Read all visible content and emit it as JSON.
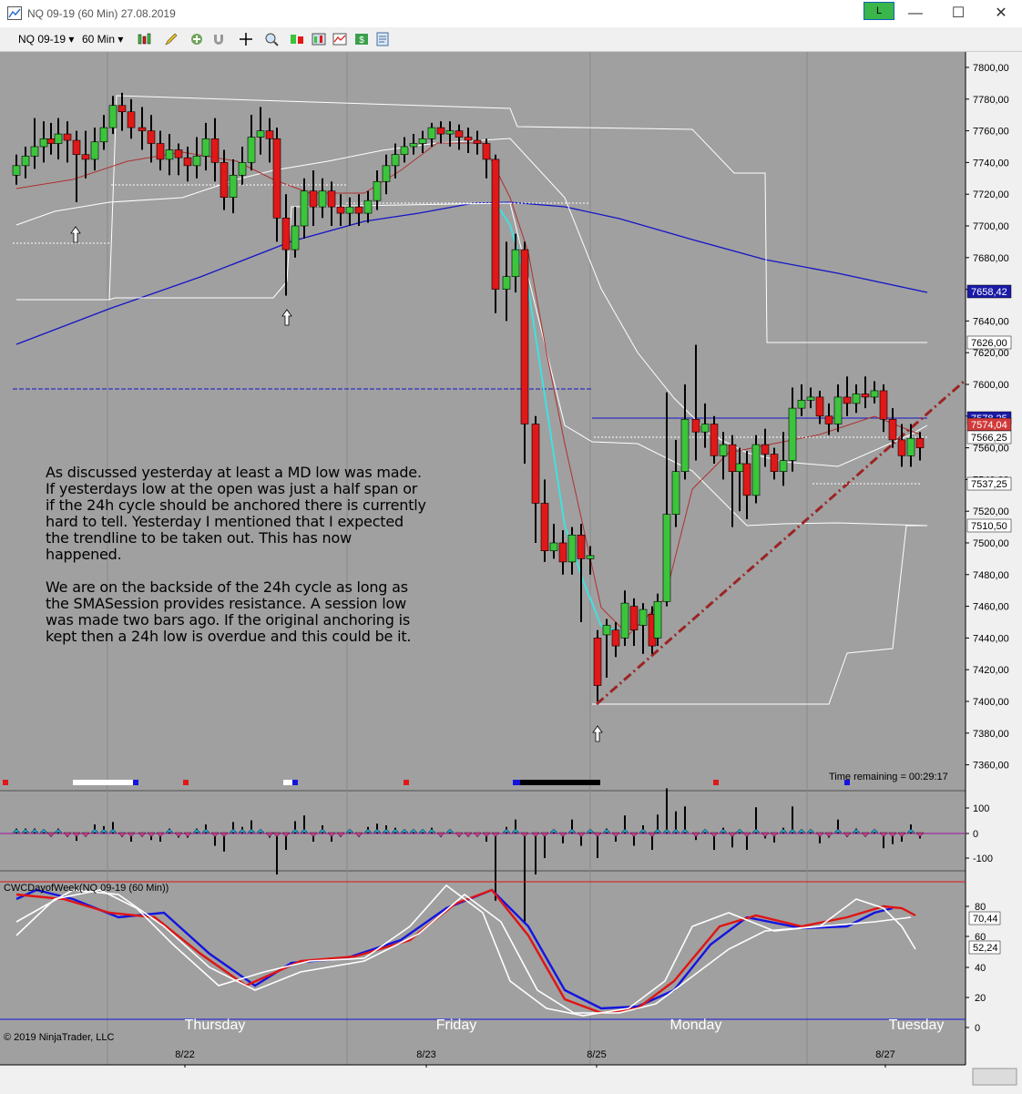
{
  "window": {
    "title": "NQ 09-19 (60 Min)  27.08.2019",
    "l_button": "L",
    "minimize": "—",
    "maximize": "☐",
    "close": "✕"
  },
  "toolbar": {
    "instrument": "NQ 09-19",
    "interval": "60 Min",
    "icons": [
      "bars-style-icon",
      "drawing-pencil-icon",
      "plus-icon",
      "magnet-icon",
      "crosshair-icon",
      "zoom-icon",
      "chart-trader-icon",
      "strategies-icon",
      "indicators-icon",
      "dollar-icon",
      "properties-icon"
    ]
  },
  "price_axis": {
    "ticks": [
      "7800,00",
      "7780,00",
      "7760,00",
      "7740,00",
      "7720,00",
      "7700,00",
      "7680,00",
      "7660,00",
      "7640,00",
      "7620,00",
      "7600,00",
      "7580,00",
      "7560,00",
      "7540,00",
      "7520,00",
      "7500,00",
      "7480,00",
      "7460,00",
      "7440,00",
      "7420,00",
      "7400,00",
      "7380,00",
      "7360,00"
    ],
    "markers": [
      {
        "label": "7658,42",
        "color": "#1a1aa8"
      },
      {
        "label": "7626,00",
        "color": "#ffffff"
      },
      {
        "label": "7578,25",
        "color": "#1a1aa8"
      },
      {
        "label": "7574,04",
        "color": "#d23a3a"
      },
      {
        "label": "7566,25",
        "color": "#ffffff"
      },
      {
        "label": "7537,25",
        "color": "#ffffff"
      },
      {
        "label": "7510,50",
        "color": "#ffffff"
      }
    ]
  },
  "annotation": "As discussed yesterday at least a MD low was made.\nIf yesterdays low at the open was just a half span or\nif the 24h cycle should be anchored there is currently\nhard to tell. Yesterday I mentioned that I expected\nthe trendline to be taken out. This has now\nhappened.\n\nWe are on the backside of the 24h cycle as long as\nthe SMASession provides resistance. A session low\nwas made two bars ago. If the original anchoring is\nkept then a 24h low is overdue and this could be it.",
  "time_remaining": "Time remaining = 00:29:17",
  "osc_axis": [
    "100",
    "0",
    "-100"
  ],
  "stoch_panel": {
    "label": "CWCDayofWeek(NQ 09-19 (60 Min))",
    "ticks": [
      "80",
      "60",
      "40",
      "20",
      "0"
    ],
    "markers": [
      "70,44",
      "52,24"
    ]
  },
  "day_labels": [
    "Thursday",
    "Friday",
    "Monday",
    "Tuesday"
  ],
  "date_labels": [
    "8/22",
    "8/23",
    "8/25",
    "8/27"
  ],
  "copyright": "© 2019 NinjaTrader, LLC",
  "colors": {
    "chart_bg": "#a0a0a0",
    "up_candle": "#3cc43c",
    "down_candle": "#e01818",
    "sma": "#1414c8",
    "trendline": "#9b2424",
    "stoch_blue": "#1414e0",
    "stoch_red": "#e01414"
  }
}
